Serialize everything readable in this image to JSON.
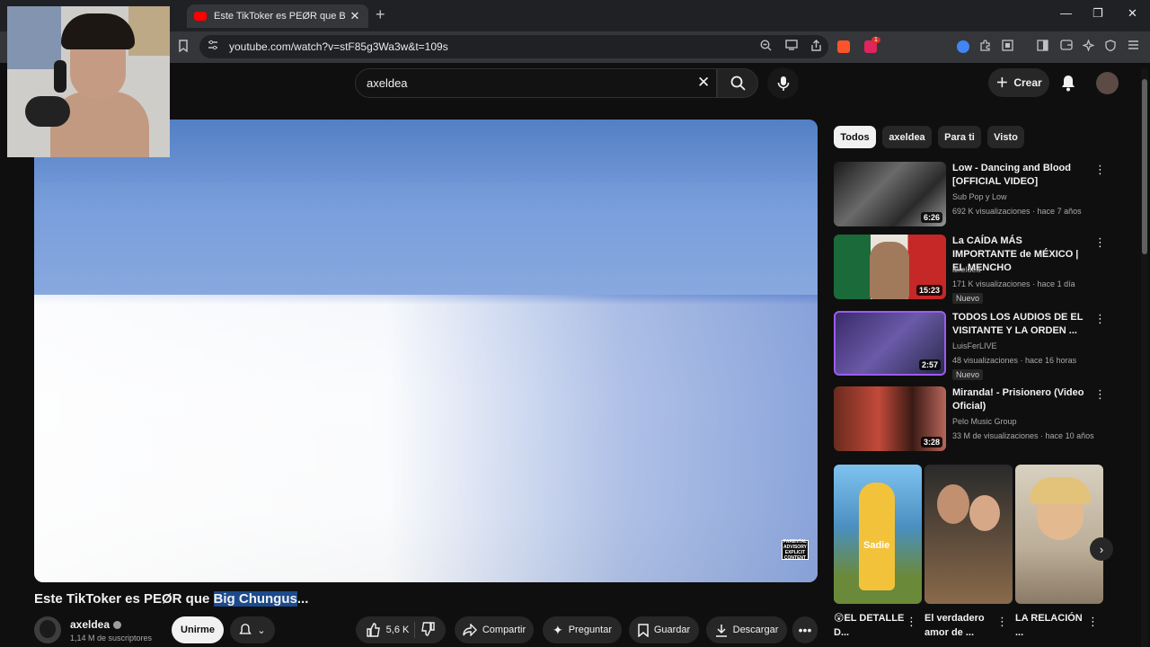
{
  "browser": {
    "tab_title": "Este TikToker es PEØR que Big Ch",
    "url": "youtube.com/watch?v=stF85g3Wa3w&t=109s",
    "ext_badge": "1"
  },
  "header": {
    "search_value": "axeldea",
    "create_label": "Crear"
  },
  "video": {
    "title_prefix": "Este TikToker es PEØR que ",
    "title_highlight": "Big Chungus",
    "title_suffix": "...",
    "advisory": "PARENTAL ADVISORY EXPLICIT CONTENT",
    "channel_name": "axeldea",
    "channel_subs": "1,14 M de suscriptores",
    "join_label": "Unirme",
    "likes": "5,6 K",
    "share_label": "Compartir",
    "ask_label": "Preguntar",
    "save_label": "Guardar",
    "download_label": "Descargar"
  },
  "chips": [
    "Todos",
    "axeldea",
    "Para ti",
    "Visto"
  ],
  "recommendations": [
    {
      "title": "Low - Dancing and Blood [OFFICIAL VIDEO]",
      "channel": "Sub Pop  y Low",
      "meta": "692 K visualizaciones · hace 7 años",
      "duration": "6:26",
      "badge": ""
    },
    {
      "title": "La CAÍDA MÁS IMPORTANTE de MÉXICO | EL MENCHO",
      "channel": "axeldea",
      "meta": "171 K visualizaciones · hace 1 día",
      "duration": "15:23",
      "badge": "Nuevo"
    },
    {
      "title": "TODOS LOS AUDIOS DE EL VISITANTE Y LA ORDEN ...",
      "channel": "LuisFerLIVE",
      "meta": "48 visualizaciones · hace 16 horas",
      "duration": "2:57",
      "badge": "Nuevo"
    },
    {
      "title": "Miranda! - Prisionero (Video Oficial)",
      "channel": "Pelo Music Group",
      "meta": "33 M de visualizaciones · hace 10 años",
      "duration": "3:28",
      "badge": ""
    }
  ],
  "shorts": [
    {
      "title": "😲EL DETALLE D...",
      "overlay": "Sadie"
    },
    {
      "title": "El verdadero amor de ...",
      "overlay": ""
    },
    {
      "title": "LA RELACIÓN ...",
      "overlay": ""
    }
  ],
  "colors": {
    "background": "#0f0f0f",
    "accent_red": "#ff0000",
    "title_highlight": "#1c4a8c"
  }
}
